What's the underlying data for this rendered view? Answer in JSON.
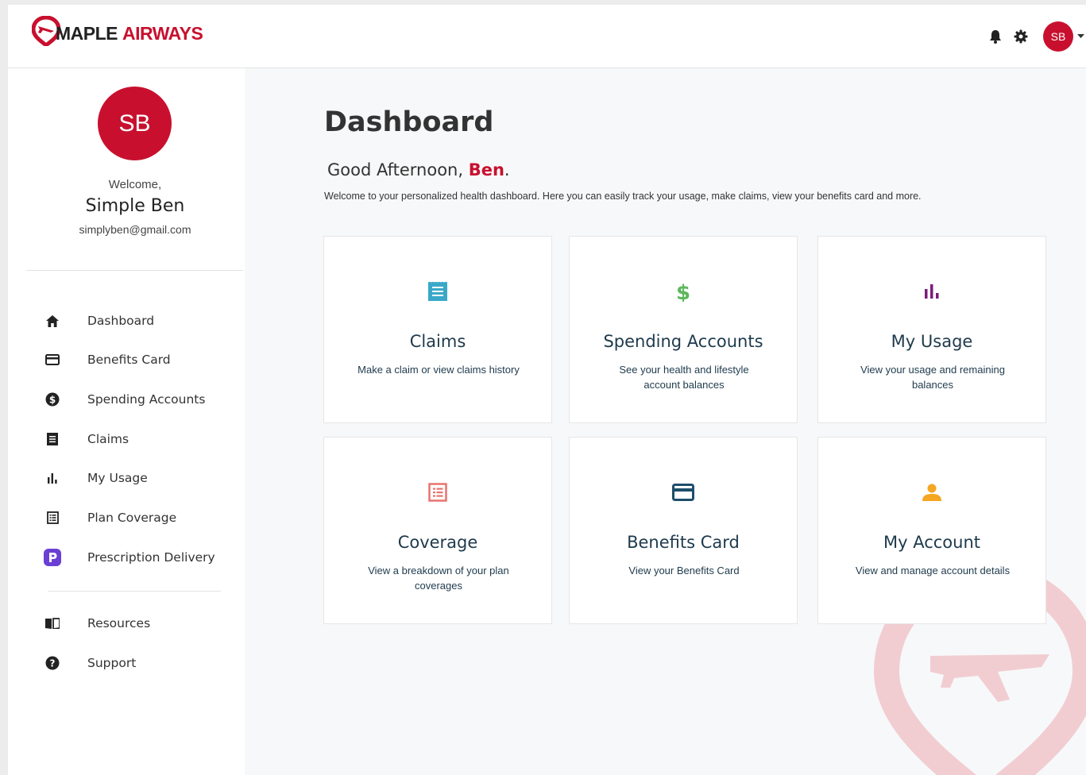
{
  "brand": {
    "name_part1": "MAPLE",
    "name_part2": "AIRWAYS",
    "color_primary": "#c8102e"
  },
  "header": {
    "icons": [
      "bell-icon",
      "gear-icon"
    ],
    "avatar_initials": "SB"
  },
  "user": {
    "initials": "SB",
    "welcome": "Welcome,",
    "name": "Simple Ben",
    "email": "simplyben@gmail.com"
  },
  "sidebar": {
    "items": [
      {
        "label": "Dashboard",
        "icon": "home-icon"
      },
      {
        "label": "Benefits Card",
        "icon": "credit-card-icon"
      },
      {
        "label": "Spending Accounts",
        "icon": "dollar-circle-icon"
      },
      {
        "label": "Claims",
        "icon": "receipt-icon"
      },
      {
        "label": "My Usage",
        "icon": "bar-chart-icon"
      },
      {
        "label": "Plan Coverage",
        "icon": "list-icon"
      },
      {
        "label": "Prescription Delivery",
        "icon": "pharmacy-icon"
      }
    ],
    "secondary": [
      {
        "label": "Resources",
        "icon": "book-icon"
      },
      {
        "label": "Support",
        "icon": "help-icon"
      }
    ]
  },
  "main": {
    "title": "Dashboard",
    "greeting_prefix": "Good Afternoon, ",
    "greeting_name": "Ben",
    "greeting_suffix": ".",
    "intro": "Welcome to your personalized health dashboard. Here you can easily track your usage, make claims, view your benefits card and more.",
    "cards": [
      {
        "title": "Claims",
        "desc": "Make a claim or view claims history",
        "icon": "receipt-icon",
        "color": "#3aa8c9"
      },
      {
        "title": "Spending Accounts",
        "desc": "See your health and lifestyle account balances",
        "icon": "dollar-icon",
        "color": "#5cb85c"
      },
      {
        "title": "My Usage",
        "desc": "View your usage and remaining balances",
        "icon": "bar-chart-icon",
        "color": "#7b1c7b"
      },
      {
        "title": "Coverage",
        "desc": "View a breakdown of your plan coverages",
        "icon": "list-icon",
        "color": "#e8736f"
      },
      {
        "title": "Benefits Card",
        "desc": "View your Benefits Card",
        "icon": "credit-card-icon",
        "color": "#1e4e6a"
      },
      {
        "title": "My Account",
        "desc": "View and manage account details",
        "icon": "person-icon",
        "color": "#f5a623"
      }
    ]
  }
}
